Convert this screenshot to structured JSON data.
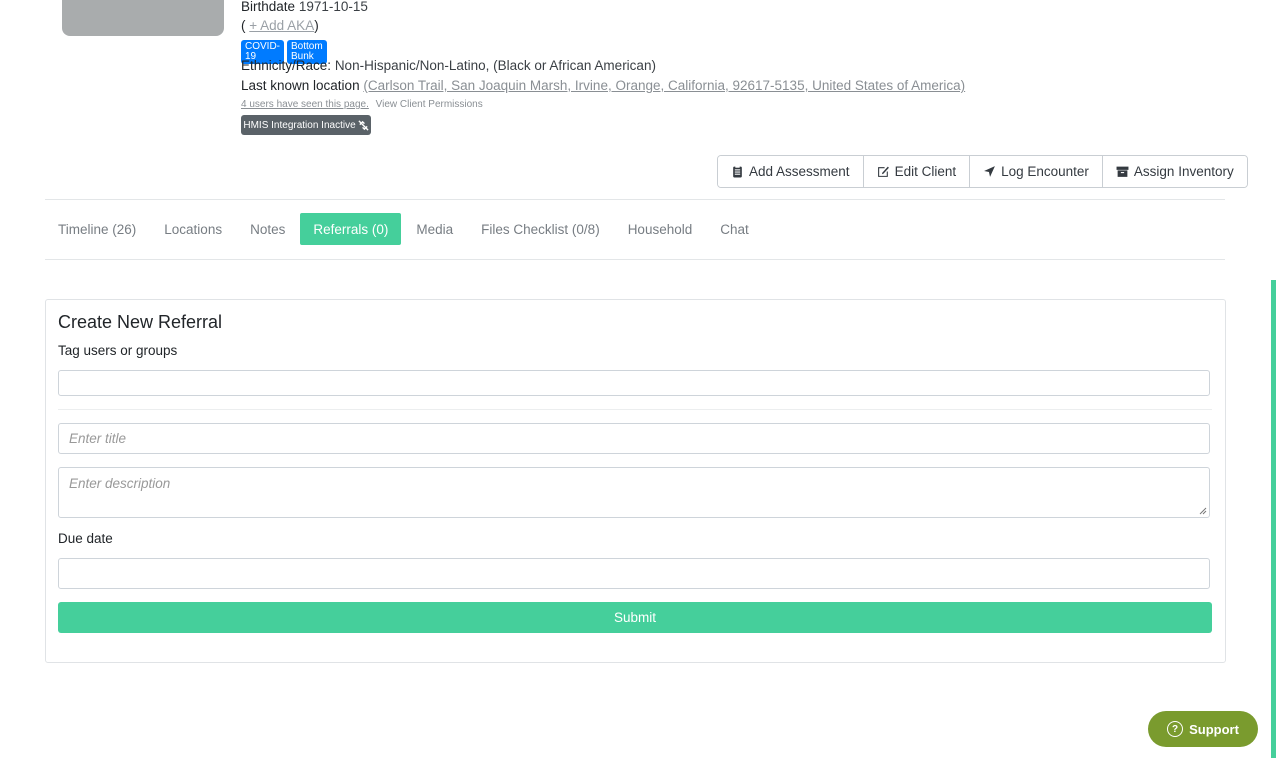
{
  "client": {
    "birthdate_label": "Birthdate",
    "birthdate_value": "1971-10-15",
    "aka_open": "(",
    "aka_link": "+ Add AKA",
    "aka_close": ")",
    "badges": [
      "COVID-19",
      "Bottom Bunk"
    ],
    "ethnicity_label": "Ethnicity/Race:",
    "ethnicity_value": "Non-Hispanic/Non-Latino, (Black or African American)",
    "location_label": "Last known location",
    "location_value": "(Carlson Trail, San Joaquin Marsh, Irvine, Orange, California, 92617-5135, United States of America)",
    "seen_text": "4 users have seen this page.",
    "permissions_link": "View Client Permissions",
    "hmis_label": "HMIS Integration Inactive"
  },
  "actions": {
    "add_assessment": "Add Assessment",
    "edit_client": "Edit Client",
    "log_encounter": "Log Encounter",
    "assign_inventory": "Assign Inventory"
  },
  "tabs": [
    {
      "label": "Timeline (26)"
    },
    {
      "label": "Locations"
    },
    {
      "label": "Notes"
    },
    {
      "label": "Referrals (0)",
      "active": true
    },
    {
      "label": "Media"
    },
    {
      "label": "Files Checklist (0/8)"
    },
    {
      "label": "Household"
    },
    {
      "label": "Chat"
    }
  ],
  "referral_form": {
    "title": "Create New Referral",
    "tag_label": "Tag users or groups",
    "tag_value": "",
    "title_placeholder": "Enter title",
    "description_placeholder": "Enter description",
    "due_label": "Due date",
    "due_value": "",
    "submit_label": "Submit"
  },
  "support": {
    "label": "Support"
  },
  "colors": {
    "accent": "#45cf9b",
    "badge": "#007bff",
    "support": "#7a9b2e",
    "hmis": "#5a6268"
  }
}
